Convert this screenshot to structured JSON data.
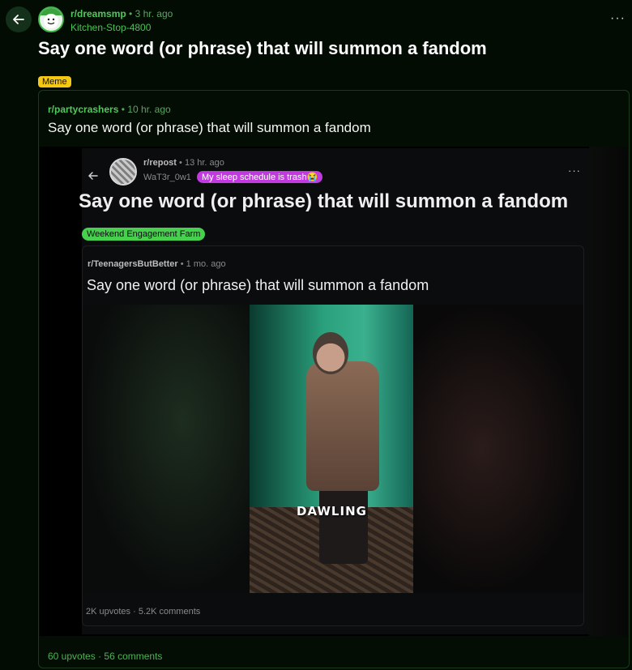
{
  "post": {
    "subreddit": "r/dreamsmp",
    "separator": "•",
    "time": "3 hr. ago",
    "author": "Kitchen-Stop-4800",
    "title": "Say one word (or phrase) that will summon a fandom",
    "flair": "Meme",
    "more": "···"
  },
  "crosspost": {
    "subreddit": "r/partycrashers",
    "separator": "•",
    "time": "10 hr. ago",
    "title": "Say one word (or phrase) that will summon a fandom",
    "stats": {
      "upvotes": "60 upvotes",
      "separator": "·",
      "comments": "56 comments"
    }
  },
  "inner_screenshot": {
    "subreddit": "r/repost",
    "separator": "•",
    "time": "13 hr. ago",
    "author": "WaT3r_0w1",
    "user_flair": "My sleep schedule is trash😭",
    "more": "···",
    "title": "Say one word (or phrase) that will summon a fandom",
    "flair": "Weekend Engagement Farm",
    "crosspost": {
      "subreddit": "r/TeenagersButBetter",
      "separator": "•",
      "time": "1 mo. ago",
      "title": "Say one word (or phrase) that will summon a fandom",
      "caption": "DAWLING",
      "stats": {
        "upvotes": "2K upvotes",
        "separator": "·",
        "comments": "5.2K comments"
      }
    }
  },
  "icons": {
    "back": "arrow-left-icon",
    "more": "more-horizontal-icon",
    "avatar": "subreddit-avatar"
  },
  "colors": {
    "background": "#030c03",
    "accent_green": "#51c95a",
    "flair_yellow": "#f5c814",
    "inner_flair_green": "#46d04e",
    "user_flair_purple": "#c13ae0"
  }
}
